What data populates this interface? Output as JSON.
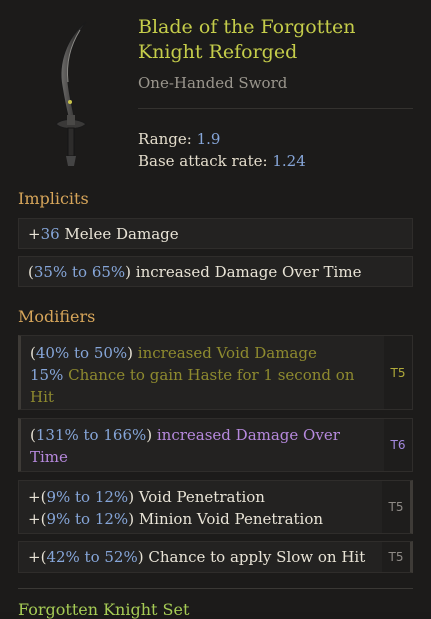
{
  "item": {
    "name": "Blade of the Forgotten Knight Reforged",
    "type": "One-Handed Sword",
    "range_label": "Range:",
    "range_value": "1.9",
    "attack_rate_label": "Base attack rate:",
    "attack_rate_value": "1.24"
  },
  "implicits": {
    "title": "Implicits",
    "items": [
      {
        "prefix": "+",
        "value": "36",
        "text": " Melee Damage"
      },
      {
        "open": "(",
        "v1": "35%",
        "to": " to ",
        "v2": "65%",
        "close": ")",
        "text": " increased Damage Over Time"
      }
    ]
  },
  "modifiers": {
    "title": "Modifiers",
    "items": [
      {
        "line1": {
          "open": "(",
          "v1": "40%",
          "to": " to ",
          "v2": "50%",
          "close": ")",
          "text": " increased Void Damage"
        },
        "line2": {
          "v": "15%",
          "text": " Chance to gain Haste for 1 second on Hit"
        },
        "tier": "T5",
        "colors": {
          "tier": "#b0aa3a"
        }
      },
      {
        "line1": {
          "open": "(",
          "v1": "131%",
          "to": " to ",
          "v2": "166%",
          "close": ")",
          "text": " increased Damage Over Time"
        },
        "tier": "T6",
        "colors": {
          "tier": "#a58ae0"
        }
      },
      {
        "line1": {
          "plus": "+",
          "open": "(",
          "v1": "9%",
          "to": " to ",
          "v2": "12%",
          "close": ")",
          "text": " Void Penetration"
        },
        "line2": {
          "plus": "+",
          "open": "(",
          "v1": "9%",
          "to": " to ",
          "v2": "12%",
          "close": ")",
          "text": " Minion Void Penetration"
        },
        "tier": "T5",
        "colors": {
          "tier": "#8e8a86"
        }
      },
      {
        "line1": {
          "plus": "+",
          "open": "(",
          "v1": "42%",
          "to": " to ",
          "v2": "52%",
          "close": ")",
          "text": " Chance to apply Slow on Hit"
        },
        "tier": "T5",
        "colors": {
          "tier": "#8e8a86"
        }
      }
    ]
  },
  "footer": {
    "title": "Forgotten Knight Set"
  },
  "icon": {
    "name": "curved-sword-icon"
  }
}
